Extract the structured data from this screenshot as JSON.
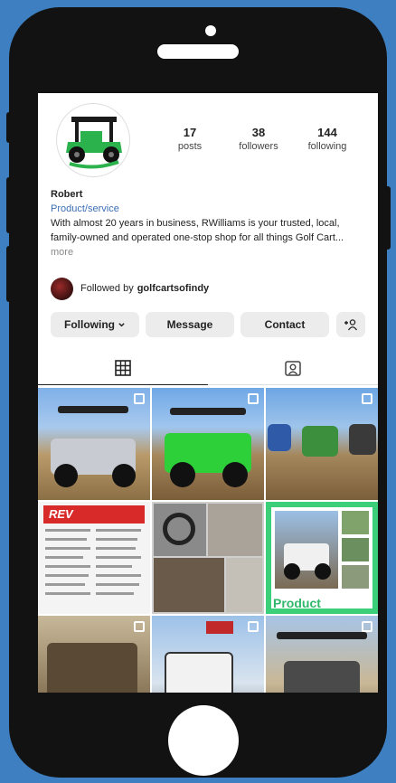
{
  "profile": {
    "name": "Robert",
    "category": "Product/service",
    "bio": "With almost 20 years in business, RWilliams is your trusted, local, family-owned and operated one-stop shop for all things Golf Cart...",
    "more_label": "more",
    "followed_by_prefix": "Followed by",
    "followed_by_user": "golfcartsofindy"
  },
  "stats": {
    "posts": {
      "value": "17",
      "label": "posts"
    },
    "followers": {
      "value": "38",
      "label": "followers"
    },
    "following": {
      "value": "144",
      "label": "following"
    }
  },
  "actions": {
    "following": "Following",
    "message": "Message",
    "contact": "Contact",
    "add_user": "+⁠ᴬ"
  },
  "tabs": {
    "grid_icon": "grid-icon",
    "tagged_icon": "tagged-person-icon"
  },
  "posts": [
    {
      "overlay": ""
    },
    {
      "overlay": ""
    },
    {
      "overlay": ""
    },
    {
      "overlay": "REV"
    },
    {
      "overlay": ""
    },
    {
      "overlay": "Product"
    },
    {
      "overlay": ""
    },
    {
      "overlay": ""
    },
    {
      "overlay": ""
    }
  ],
  "colors": {
    "background": "#3d7fc0",
    "phone": "#121212",
    "link": "#3b6fb6",
    "button": "#ececec",
    "accent_green": "#2fb86a"
  }
}
